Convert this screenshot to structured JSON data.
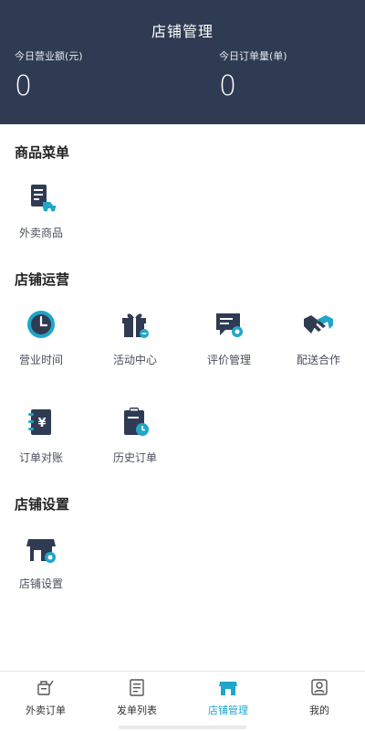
{
  "header": {
    "title": "店铺管理",
    "revenue_label": "今日营业额(元)",
    "revenue_value": "0",
    "orders_label": "今日订单量(单)",
    "orders_value": "0"
  },
  "sections": {
    "goods": {
      "title": "商品菜单",
      "items": [
        {
          "label": "外卖商品",
          "icon": "takeout-goods-icon"
        }
      ]
    },
    "operations": {
      "title": "店铺运营",
      "items": [
        {
          "label": "营业时间",
          "icon": "clock-icon"
        },
        {
          "label": "活动中心",
          "icon": "gift-icon"
        },
        {
          "label": "评价管理",
          "icon": "review-icon"
        },
        {
          "label": "配送合作",
          "icon": "handshake-icon"
        },
        {
          "label": "订单对账",
          "icon": "ledger-icon"
        },
        {
          "label": "历史订单",
          "icon": "history-order-icon"
        }
      ]
    },
    "settings": {
      "title": "店铺设置",
      "items": [
        {
          "label": "店铺设置",
          "icon": "shop-settings-icon"
        }
      ]
    }
  },
  "tabbar": {
    "tabs": [
      {
        "label": "外卖订单",
        "icon": "takeout-order-icon"
      },
      {
        "label": "发单列表",
        "icon": "dispatch-list-icon"
      },
      {
        "label": "店铺管理",
        "icon": "shop-icon",
        "active": true
      },
      {
        "label": "我的",
        "icon": "profile-icon"
      }
    ]
  },
  "colors": {
    "header_bg": "#2f3b52",
    "accent": "#1fa6c9",
    "icon_dark": "#2f3b52"
  }
}
